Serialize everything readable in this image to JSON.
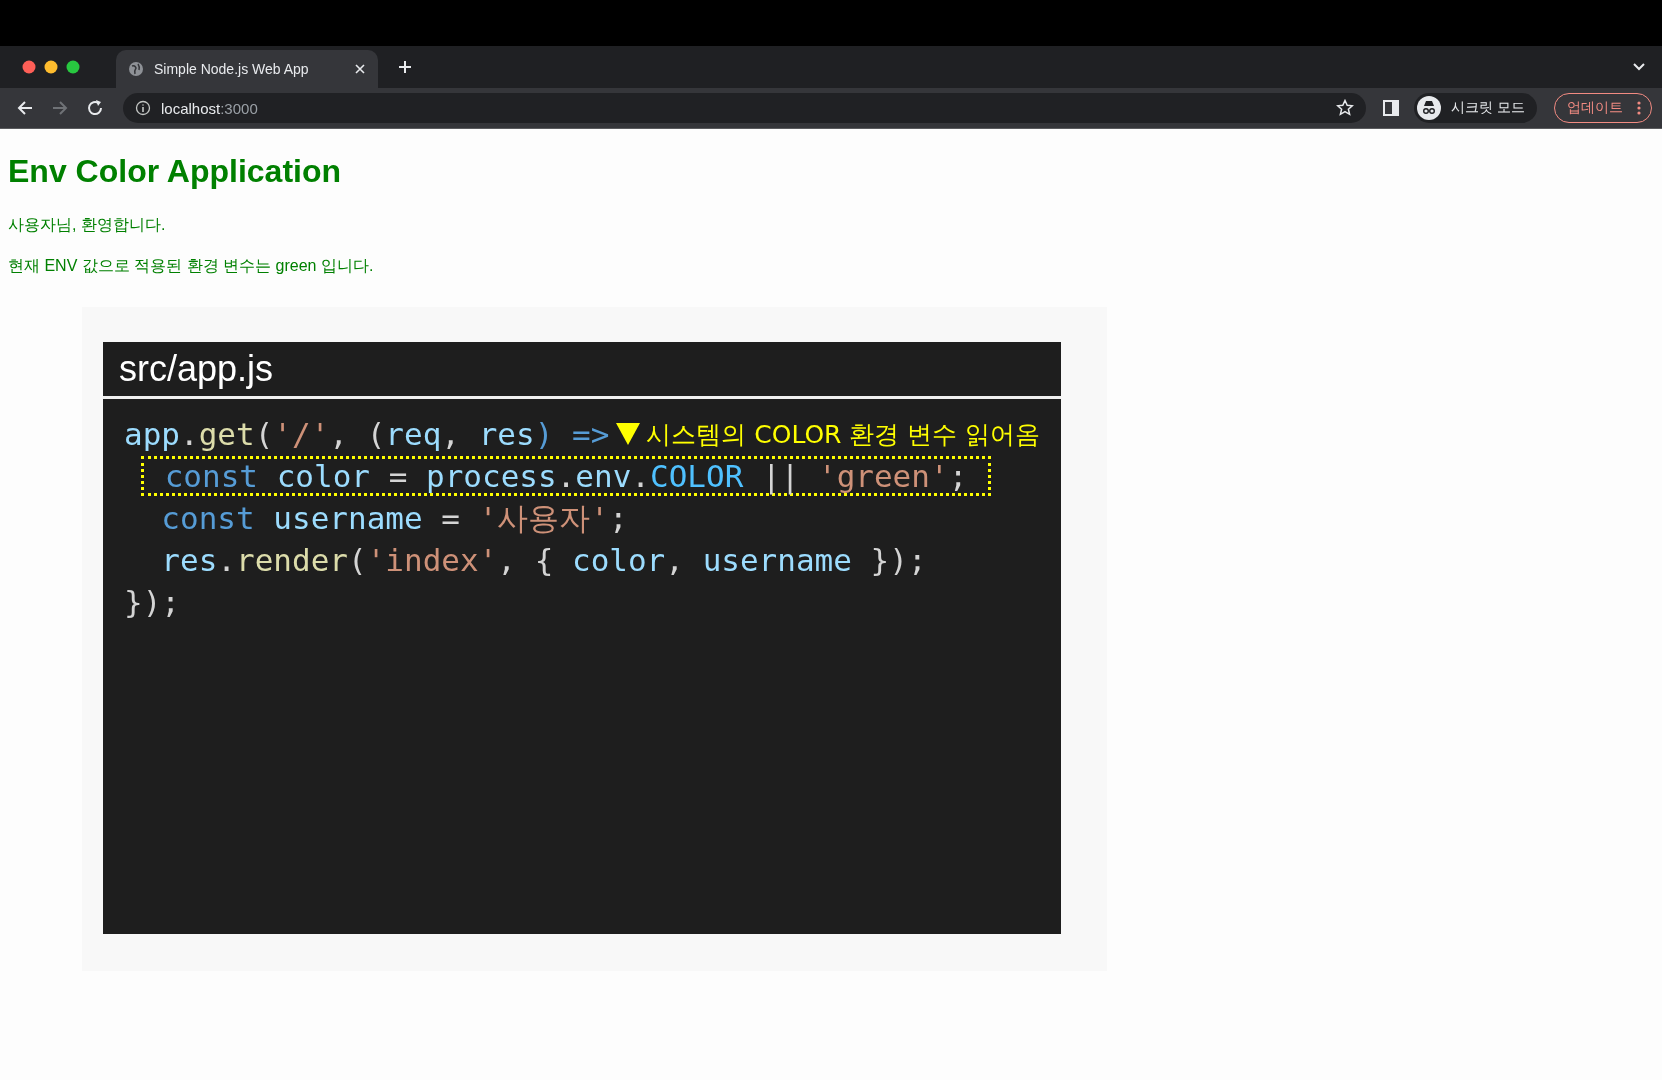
{
  "browser": {
    "tab": {
      "title": "Simple Node.js Web App",
      "selected": true
    },
    "url": {
      "host": "localhost",
      "port": ":3000"
    },
    "profile": "시크릿 모드",
    "update_button": "업데이트"
  },
  "page": {
    "title": "Env Color Application",
    "greeting": "사용자님, 환영합니다.",
    "message": "현재 ENV 값으로 적용된 환경 변수는 green 입니다.",
    "code_image": {
      "filename": "src/app.js",
      "annotation": "시스템의 COLOR 환경 변수 읽어옴",
      "lines": [
        {
          "highlighted": false,
          "tokens": [
            {
              "text": "app",
              "kind": "var"
            },
            {
              "text": ".",
              "kind": "punc"
            },
            {
              "text": "get",
              "kind": "fn"
            },
            {
              "text": "(",
              "kind": "punc"
            },
            {
              "text": "'/'",
              "kind": "str"
            },
            {
              "text": ", (",
              "kind": "punc"
            },
            {
              "text": "req",
              "kind": "var"
            },
            {
              "text": ", ",
              "kind": "punc"
            },
            {
              "text": "res",
              "kind": "var"
            },
            {
              "text": ") =>",
              "kind": "kw"
            }
          ]
        },
        {
          "highlighted": true,
          "tokens": [
            {
              "text": " const ",
              "kind": "kw"
            },
            {
              "text": "color",
              "kind": "var"
            },
            {
              "text": " = ",
              "kind": "punc"
            },
            {
              "text": "process",
              "kind": "var"
            },
            {
              "text": ".",
              "kind": "punc"
            },
            {
              "text": "env",
              "kind": "var"
            },
            {
              "text": ".",
              "kind": "punc"
            },
            {
              "text": "COLOR",
              "kind": "const"
            },
            {
              "text": " || ",
              "kind": "punc"
            },
            {
              "text": "'green'",
              "kind": "str"
            },
            {
              "text": "; ",
              "kind": "punc"
            }
          ]
        },
        {
          "highlighted": false,
          "tokens": [
            {
              "text": "  const ",
              "kind": "kw"
            },
            {
              "text": "username",
              "kind": "var"
            },
            {
              "text": " = ",
              "kind": "punc"
            },
            {
              "text": "'사용자'",
              "kind": "str"
            },
            {
              "text": ";",
              "kind": "punc"
            }
          ]
        },
        {
          "highlighted": false,
          "tokens": [
            {
              "text": "  res",
              "kind": "var"
            },
            {
              "text": ".",
              "kind": "punc"
            },
            {
              "text": "render",
              "kind": "fn"
            },
            {
              "text": "(",
              "kind": "punc"
            },
            {
              "text": "'index'",
              "kind": "str"
            },
            {
              "text": ", { ",
              "kind": "punc"
            },
            {
              "text": "color",
              "kind": "var"
            },
            {
              "text": ", ",
              "kind": "punc"
            },
            {
              "text": "username",
              "kind": "var"
            },
            {
              "text": " });",
              "kind": "punc"
            }
          ]
        },
        {
          "highlighted": false,
          "tokens": [
            {
              "text": "});",
              "kind": "punc"
            }
          ]
        }
      ]
    }
  }
}
